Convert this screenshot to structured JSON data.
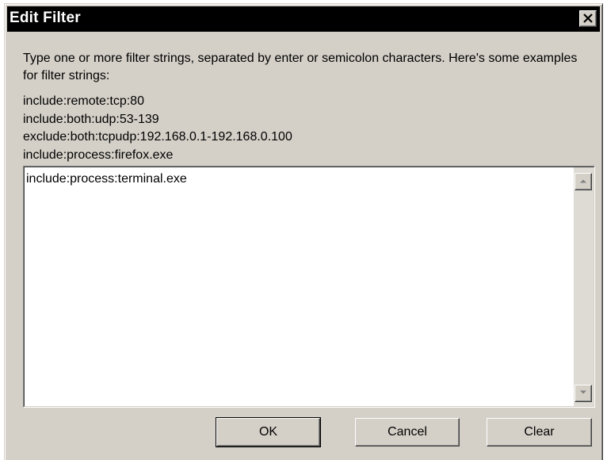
{
  "window": {
    "title": "Edit Filter",
    "close_label": "close"
  },
  "intro_text": "Type one or more filter strings, separated by enter or semicolon characters. Here's some examples for filter strings:",
  "examples": [
    "include:remote:tcp:80",
    "include:both:udp:53-139",
    "exclude:both:tcpudp:192.168.0.1-192.168.0.100",
    "include:process:firefox.exe"
  ],
  "filter_input": {
    "value": "include:process:terminal.exe"
  },
  "buttons": {
    "ok": "OK",
    "cancel": "Cancel",
    "clear": "Clear"
  },
  "colors": {
    "face": "#d4d0c8",
    "titlebar": "#000000",
    "title_text": "#ffffff"
  }
}
